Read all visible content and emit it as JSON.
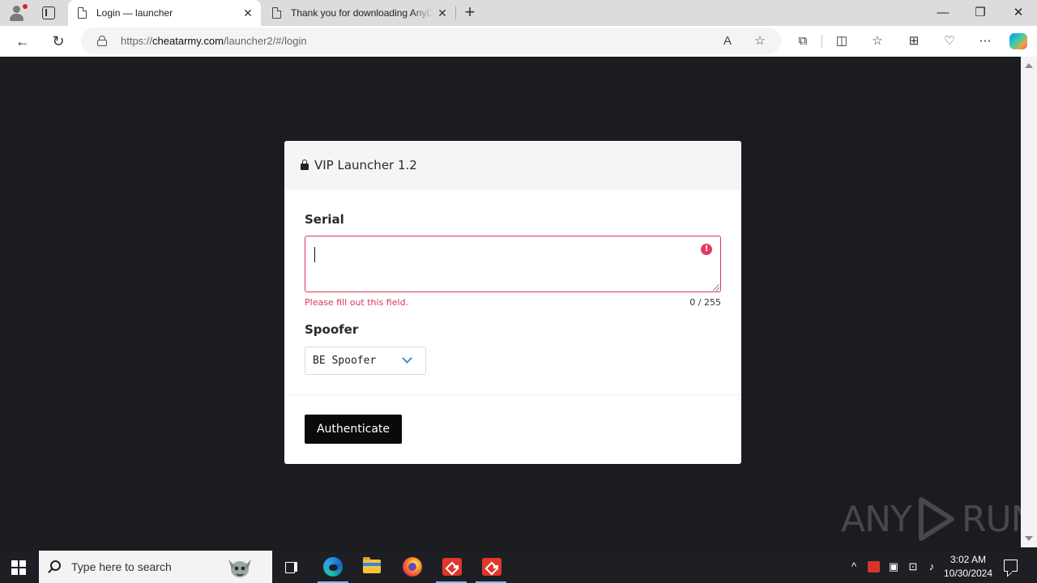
{
  "browser": {
    "tabs": [
      {
        "title": "Login — launcher",
        "active": true,
        "icon": "page-icon"
      },
      {
        "title": "Thank you for downloading AnyDesk",
        "active": false,
        "icon": "page-icon"
      }
    ],
    "address": {
      "scheme": "https://",
      "host": "cheatarmy.com",
      "path": "/launcher2/#/login"
    },
    "toolbar_icons": [
      "read-aloud-icon",
      "favorite-star-icon",
      "extensions-icon",
      "split-screen-icon",
      "favorites-icon",
      "collections-icon",
      "browser-essentials-icon",
      "more-icon",
      "copilot-icon"
    ]
  },
  "page": {
    "card": {
      "title": "VIP Launcher 1.2",
      "serial_label": "Serial",
      "serial_value": "",
      "serial_error": "Please fill out this field.",
      "serial_counter": "0 / 255",
      "spoofer_label": "Spoofer",
      "spoofer_selected": "BE Spoofer",
      "submit_label": "Authenticate"
    },
    "watermark": {
      "left": "ANY",
      "right": "RUN"
    },
    "colors": {
      "background": "#1b1c1f",
      "error": "#d9365b",
      "accent": "#3e8ed0",
      "button": "#0a0a0a"
    }
  },
  "taskbar": {
    "search_placeholder": "Type here to search",
    "apps": [
      "task-view-icon",
      "edge-icon",
      "file-explorer-icon",
      "firefox-icon",
      "anydesk-icon",
      "anydesk-icon"
    ],
    "clock": {
      "time": "3:02 AM",
      "date": "10/30/2024"
    }
  }
}
